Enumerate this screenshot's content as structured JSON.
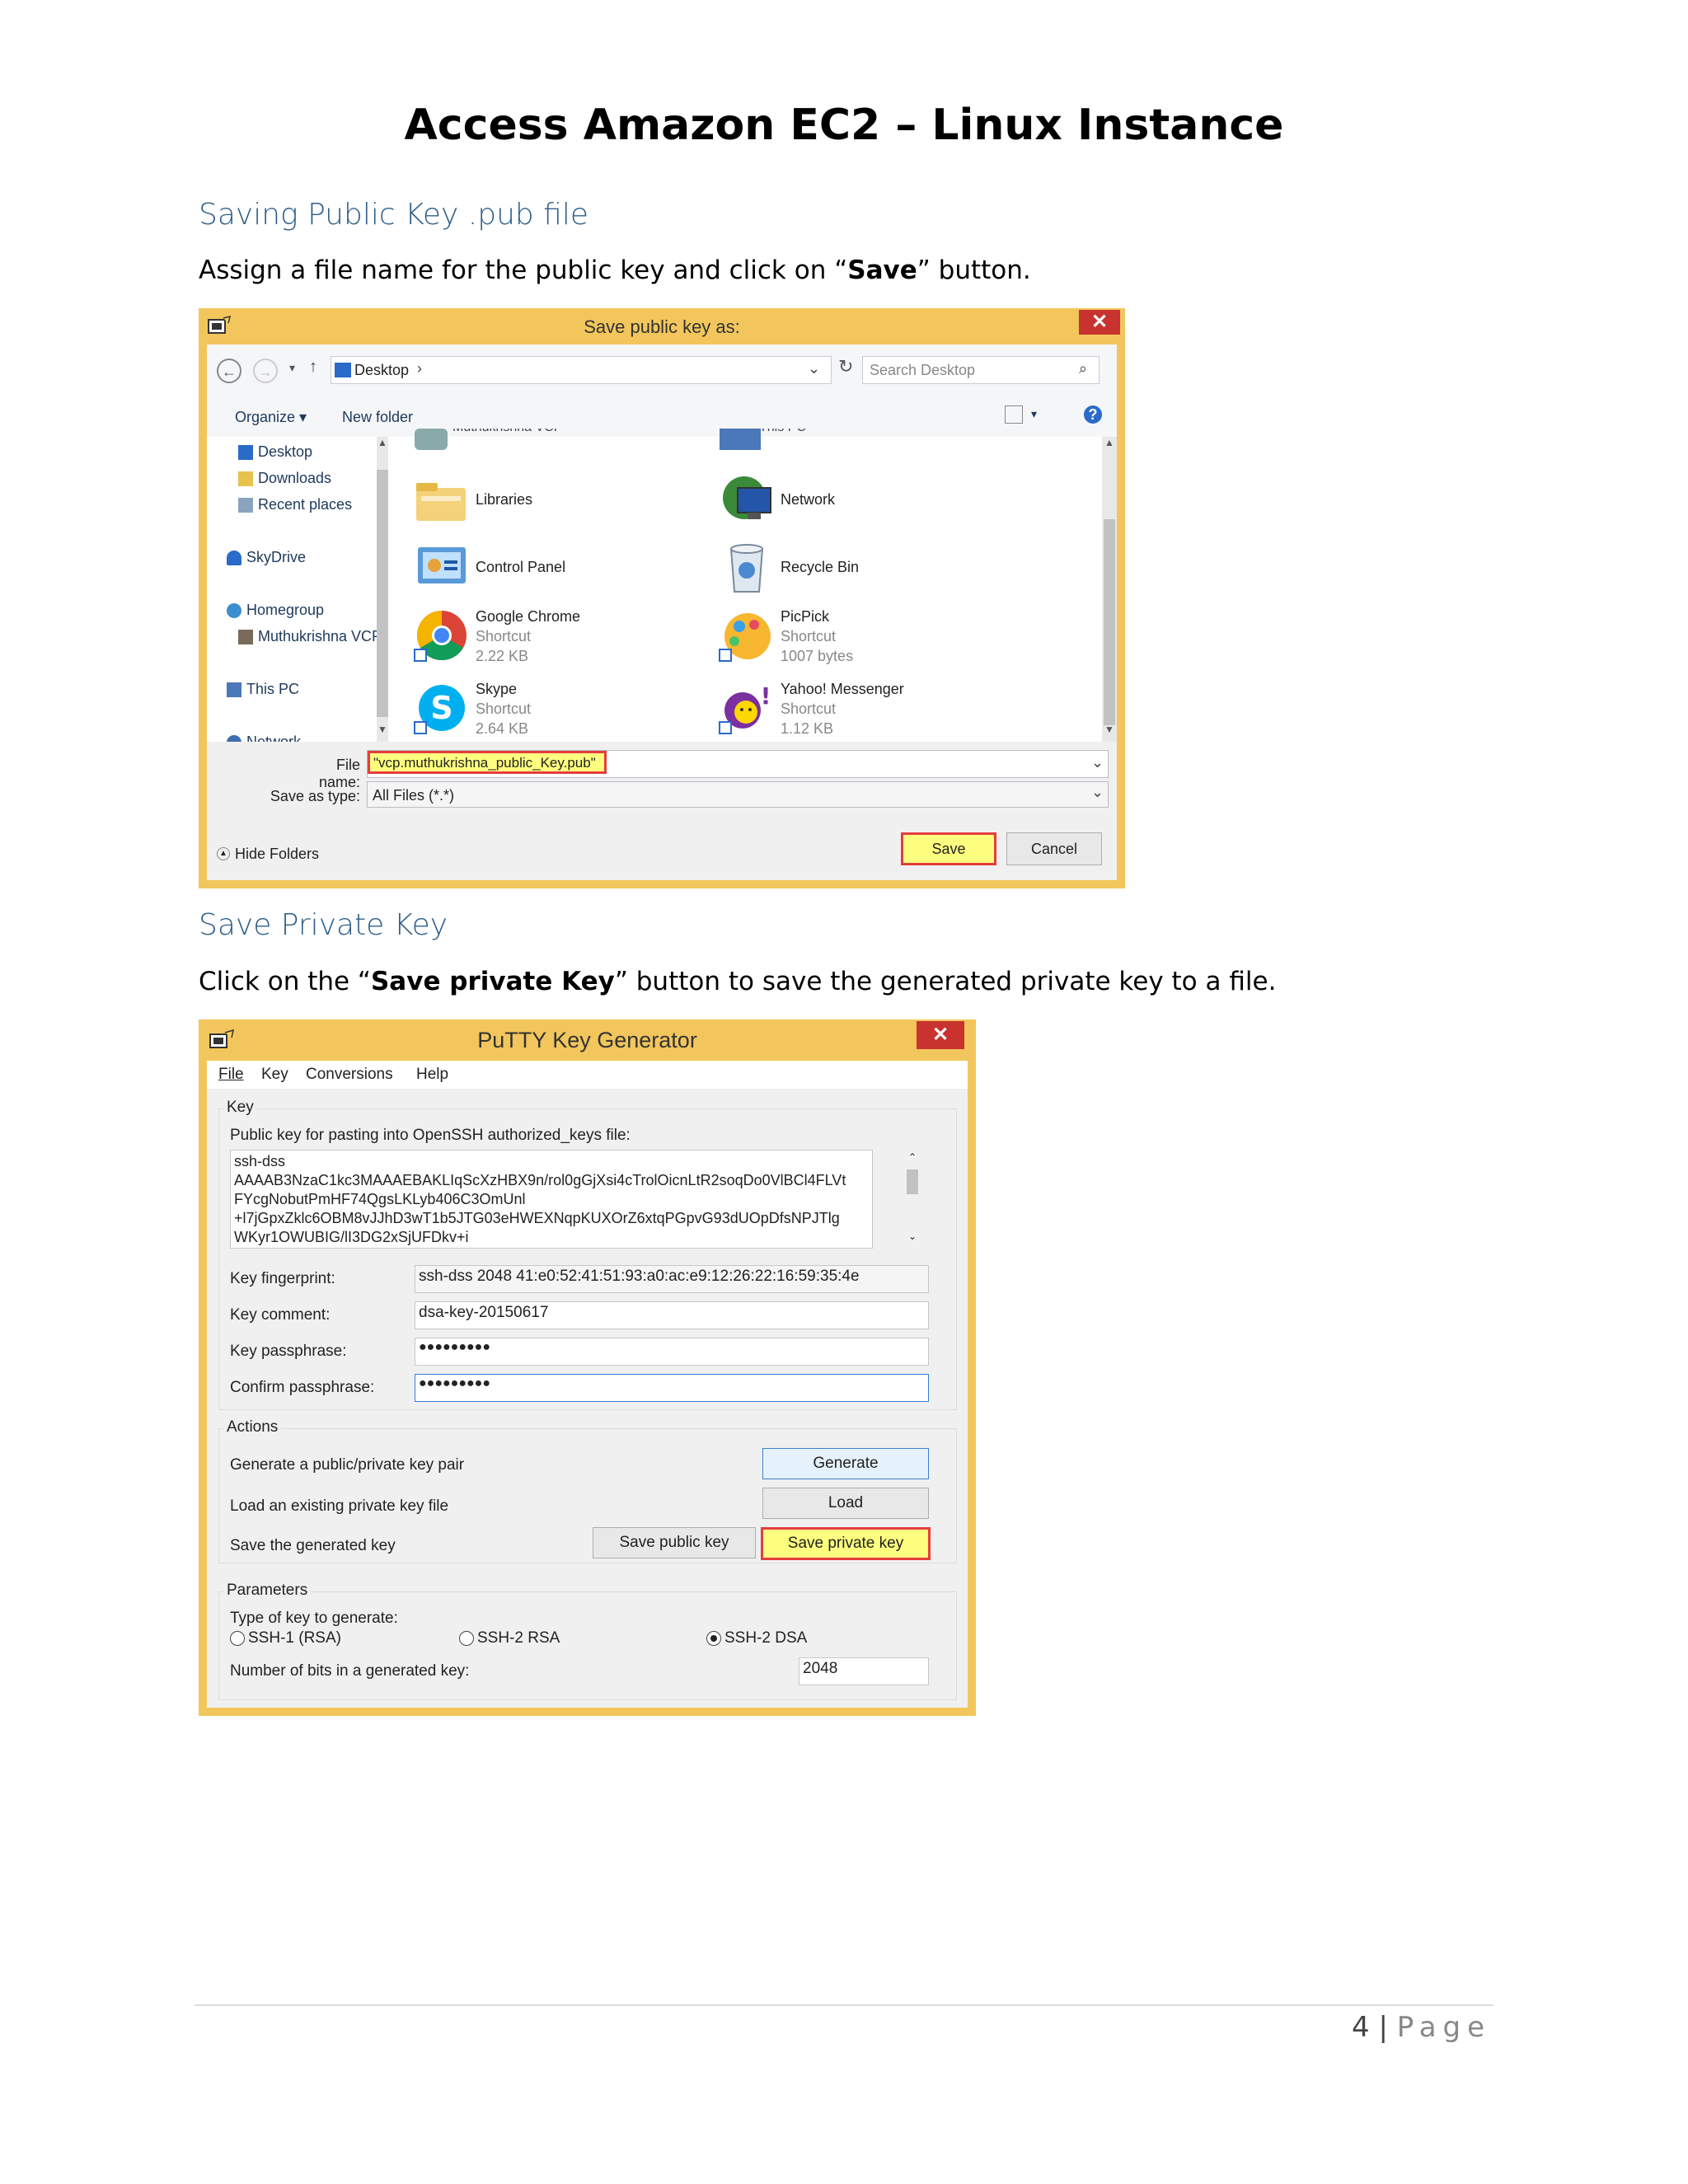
{
  "doc_title": "Access Amazon EC2 – Linux Instance",
  "section1": {
    "heading": "Saving Public Key .pub file",
    "text_a": "Assign a file name for the public key and click on “",
    "text_b": "Save",
    "text_c": "” button."
  },
  "save_dialog": {
    "title": "Save public key as:",
    "close": "✕",
    "path": "Desktop",
    "search_placeholder": "Search Desktop",
    "organize": "Organize ▾",
    "new_folder": "New folder",
    "tree": [
      "Desktop",
      "Downloads",
      "Recent places",
      "SkyDrive",
      "Homegroup",
      "Muthukrishna VCP",
      "This PC",
      "Network"
    ],
    "partial_top": [
      "Muthukrishna VCP",
      "This PC"
    ],
    "items": [
      {
        "name": "Libraries",
        "type": "",
        "size": ""
      },
      {
        "name": "Network",
        "type": "",
        "size": ""
      },
      {
        "name": "Control Panel",
        "type": "",
        "size": ""
      },
      {
        "name": "Recycle Bin",
        "type": "",
        "size": ""
      },
      {
        "name": "Google Chrome",
        "type": "Shortcut",
        "size": "2.22 KB"
      },
      {
        "name": "PicPick",
        "type": "Shortcut",
        "size": "1007 bytes"
      },
      {
        "name": "Skype",
        "type": "Shortcut",
        "size": "2.64 KB"
      },
      {
        "name": "Yahoo! Messenger",
        "type": "Shortcut",
        "size": "1.12 KB"
      }
    ],
    "file_name_label": "File name:",
    "file_name_value": "\"vcp.muthukrishna_public_Key.pub\"",
    "save_type_label": "Save as type:",
    "save_type_value": "All Files (*.*)",
    "hide_folders": "Hide Folders",
    "save_btn": "Save",
    "cancel_btn": "Cancel"
  },
  "section2": {
    "heading": "Save Private Key",
    "text_a": "Click on the “",
    "text_b": "Save private Key",
    "text_c": "” button to save the generated private key to a file."
  },
  "putty": {
    "title": "PuTTY Key Generator",
    "close": "✕",
    "menu": [
      "File",
      "Key",
      "Conversions",
      "Help"
    ],
    "key_group": "Key",
    "pub_label": "Public key for pasting into OpenSSH authorized_keys file:",
    "pub_lines": [
      "ssh-dss",
      "AAAAB3NzaC1kc3MAAAEBAKLIqScXzHBX9n/rol0gGjXsi4cTrolOicnLtR2soqDo0VlBCl4FLVt",
      "FYcgNobutPmHF74QgsLKLyb406C3OmUnl",
      "+l7jGpxZklc6OBM8vJJhD3wT1b5JTG03eHWEXNqpKUXOrZ6xtqPGpvG93dUOpDfsNPJTlg",
      "WKyr1OWUBIG/lI3DG2xSjUFDkv+i"
    ],
    "fingerprint_label": "Key fingerprint:",
    "fingerprint_value": "ssh-dss 2048 41:e0:52:41:51:93:a0:ac:e9:12:26:22:16:59:35:4e",
    "comment_label": "Key comment:",
    "comment_value": "dsa-key-20150617",
    "pass_label": "Key passphrase:",
    "pass_value": "●●●●●●●●●",
    "confirm_label": "Confirm passphrase:",
    "confirm_value": "●●●●●●●●●",
    "actions_group": "Actions",
    "gen_text": "Generate a public/private key pair",
    "gen_btn": "Generate",
    "load_text": "Load an existing private key file",
    "load_btn": "Load",
    "save_text": "Save the generated key",
    "save_pub_btn": "Save public key",
    "save_priv_btn": "Save private key",
    "params_group": "Parameters",
    "type_label": "Type of key to generate:",
    "radio1": "SSH-1 (RSA)",
    "radio2": "SSH-2 RSA",
    "radio3": "SSH-2 DSA",
    "bits_label": "Number of bits in a generated key:",
    "bits_value": "2048"
  },
  "footer": {
    "page_num": "4",
    "sep": " | ",
    "page_word": "Page"
  }
}
